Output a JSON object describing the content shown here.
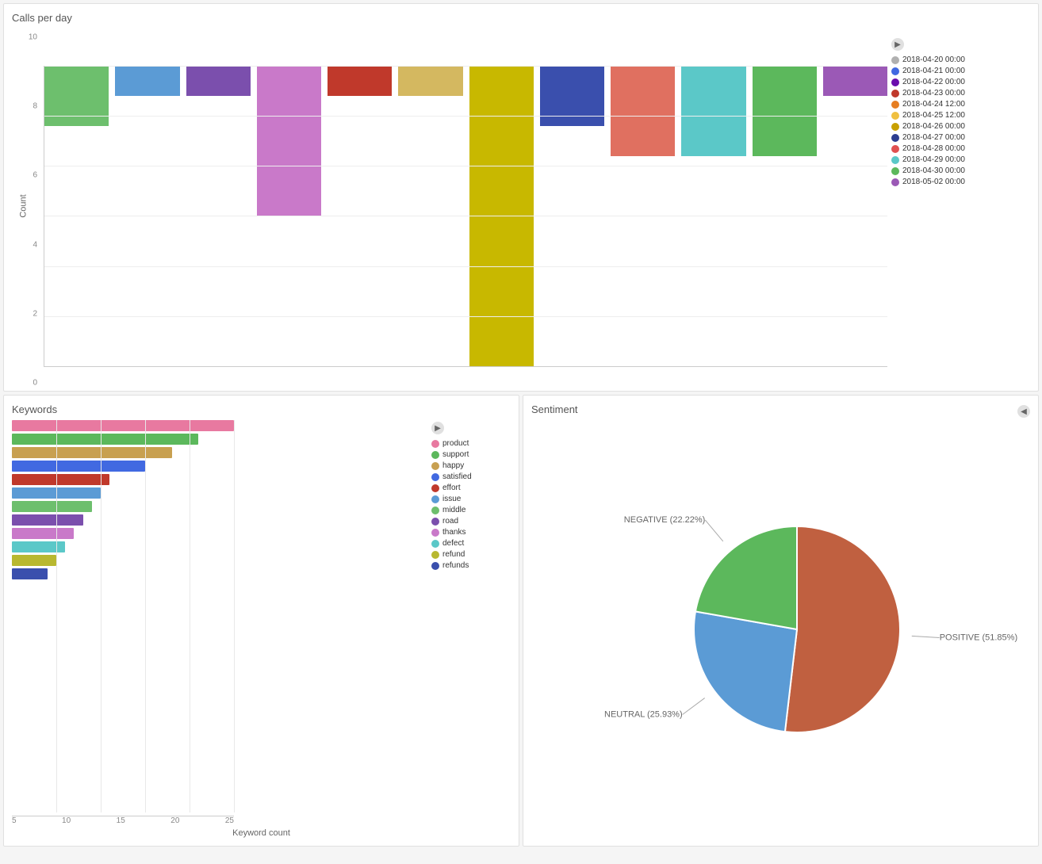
{
  "topChart": {
    "title": "Calls per day",
    "yAxisLabel": "Count",
    "yTicks": [
      0,
      2,
      4,
      6,
      8,
      10
    ],
    "legend": [
      {
        "label": "2018-04-20 00:00",
        "color": "#b0b0b0"
      },
      {
        "label": "2018-04-21 00:00",
        "color": "#4169e1"
      },
      {
        "label": "2018-04-22 00:00",
        "color": "#6a0dad"
      },
      {
        "label": "2018-04-23 00:00",
        "color": "#c0392b"
      },
      {
        "label": "2018-04-24 12:00",
        "color": "#e67e22"
      },
      {
        "label": "2018-04-25 12:00",
        "color": "#f0c040"
      },
      {
        "label": "2018-04-26 00:00",
        "color": "#c8a000"
      },
      {
        "label": "2018-04-27 00:00",
        "color": "#2c3e90"
      },
      {
        "label": "2018-04-28 00:00",
        "color": "#e05050"
      },
      {
        "label": "2018-04-29 00:00",
        "color": "#5bc8c8"
      },
      {
        "label": "2018-04-30 00:00",
        "color": "#5cb85c"
      },
      {
        "label": "2018-05-02 00:00",
        "color": "#9b59b6"
      }
    ],
    "bars": [
      {
        "height": 2,
        "color": "#6dbf6d"
      },
      {
        "height": 1,
        "color": "#5b9bd5"
      },
      {
        "height": 1,
        "color": "#7b4fad"
      },
      {
        "height": 5,
        "color": "#c979c9"
      },
      {
        "height": 1,
        "color": "#c0392b"
      },
      {
        "height": 1,
        "color": "#d4b860"
      },
      {
        "height": 10,
        "color": "#c8b800"
      },
      {
        "height": 2,
        "color": "#3a4fad"
      },
      {
        "height": 3,
        "color": "#e07060"
      },
      {
        "height": 3,
        "color": "#5bc8c8"
      },
      {
        "height": 3,
        "color": "#5cb85c"
      },
      {
        "height": 1,
        "color": "#9b59b6"
      }
    ]
  },
  "keywords": {
    "title": "Keywords",
    "xAxisLabel": "Keyword count",
    "xTicks": [
      "5",
      "10",
      "15",
      "20",
      "25"
    ],
    "maxValue": 25,
    "legend": [
      {
        "label": "product",
        "color": "#e879a0"
      },
      {
        "label": "support",
        "color": "#5cb85c"
      },
      {
        "label": "happy",
        "color": "#c8a050"
      },
      {
        "label": "satisfied",
        "color": "#4169e1"
      },
      {
        "label": "effort",
        "color": "#c0392b"
      },
      {
        "label": "issue",
        "color": "#5b9bd5"
      },
      {
        "label": "middle",
        "color": "#6dbf6d"
      },
      {
        "label": "road",
        "color": "#7b4fad"
      },
      {
        "label": "thanks",
        "color": "#c979c9"
      },
      {
        "label": "defect",
        "color": "#5bc8c8"
      },
      {
        "label": "refund",
        "color": "#b8b830"
      },
      {
        "label": "refunds",
        "color": "#3a4fad"
      }
    ],
    "bars": [
      {
        "label": "product",
        "value": 25,
        "color": "#e879a0"
      },
      {
        "label": "support",
        "value": 21,
        "color": "#5cb85c"
      },
      {
        "label": "happy",
        "value": 18,
        "color": "#c8a050"
      },
      {
        "label": "satisfied",
        "value": 15,
        "color": "#4169e1"
      },
      {
        "label": "effort",
        "value": 11,
        "color": "#c0392b"
      },
      {
        "label": "issue",
        "value": 10,
        "color": "#5b9bd5"
      },
      {
        "label": "middle",
        "value": 9,
        "color": "#6dbf6d"
      },
      {
        "label": "road",
        "value": 8,
        "color": "#7b4fad"
      },
      {
        "label": "thanks",
        "value": 7,
        "color": "#c979c9"
      },
      {
        "label": "defect",
        "value": 6,
        "color": "#5bc8c8"
      },
      {
        "label": "refund",
        "value": 5,
        "color": "#b8b830"
      },
      {
        "label": "refunds",
        "value": 4,
        "color": "#3a4fad"
      }
    ]
  },
  "sentiment": {
    "title": "Sentiment",
    "slices": [
      {
        "label": "POSITIVE",
        "percent": 51.85,
        "color": "#c06040"
      },
      {
        "label": "NEUTRAL",
        "percent": 25.93,
        "color": "#5b9bd5"
      },
      {
        "label": "NEGATIVE",
        "percent": 22.22,
        "color": "#5cb85c"
      }
    ],
    "labels": {
      "positive": "POSITIVE (51.85%)",
      "neutral": "NEUTRAL (25.93%)",
      "negative": "NEGATIVE (22.22%)"
    }
  },
  "arrows": {
    "left": "◀",
    "right": "▶"
  }
}
